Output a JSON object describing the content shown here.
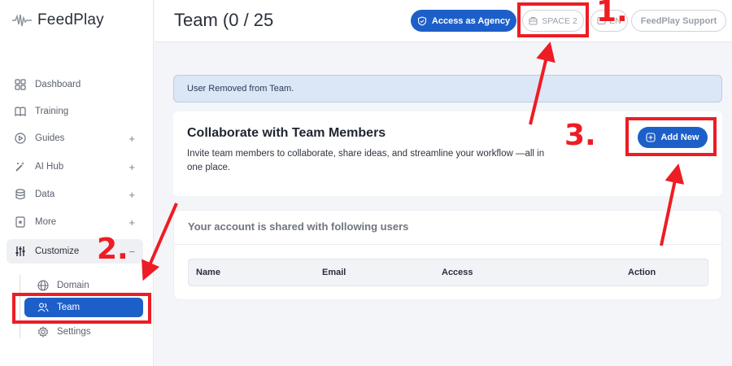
{
  "app": {
    "name": "FeedPlay"
  },
  "sidebar": {
    "items": [
      {
        "label": "Dashboard",
        "icon": "dashboard-icon",
        "expandable": false
      },
      {
        "label": "Training",
        "icon": "book-icon",
        "expandable": false
      },
      {
        "label": "Guides",
        "icon": "play-circle-icon",
        "expandable": true,
        "toggle": "+"
      },
      {
        "label": "AI Hub",
        "icon": "magic-wand-icon",
        "expandable": true,
        "toggle": "+"
      },
      {
        "label": "Data",
        "icon": "database-icon",
        "expandable": true,
        "toggle": "+"
      },
      {
        "label": "More",
        "icon": "star-doc-icon",
        "expandable": true,
        "toggle": "+"
      },
      {
        "label": "Customize",
        "icon": "sliders-icon",
        "expandable": true,
        "toggle": "−"
      }
    ],
    "subitems": [
      {
        "label": "Domain",
        "icon": "globe-icon"
      },
      {
        "label": "Team",
        "icon": "users-icon",
        "active": true
      },
      {
        "label": "Settings",
        "icon": "gear-icon"
      }
    ]
  },
  "header": {
    "title": "Team (0 / 25",
    "agency_label": "Access as Agency",
    "space_label": "SPACE 2",
    "lang_label": "EN",
    "support_label": "FeedPlay Support"
  },
  "alert": {
    "message": "User Removed from Team."
  },
  "collaborate": {
    "title": "Collaborate with Team Members",
    "description": "Invite team members to collaborate, share ideas, and streamline your workflow —all in one place.",
    "add_label": "Add New"
  },
  "shared": {
    "title": "Your account is shared with following users",
    "columns": [
      "Name",
      "Email",
      "Access",
      "Action"
    ]
  },
  "annotations": {
    "n1": "1.",
    "n2": "2.",
    "n3": "3.",
    "color": "#ee1c24"
  },
  "colors": {
    "primary": "#1d5fc9",
    "alert_bg": "#dbe6f6",
    "annotation": "#ee1c24"
  }
}
